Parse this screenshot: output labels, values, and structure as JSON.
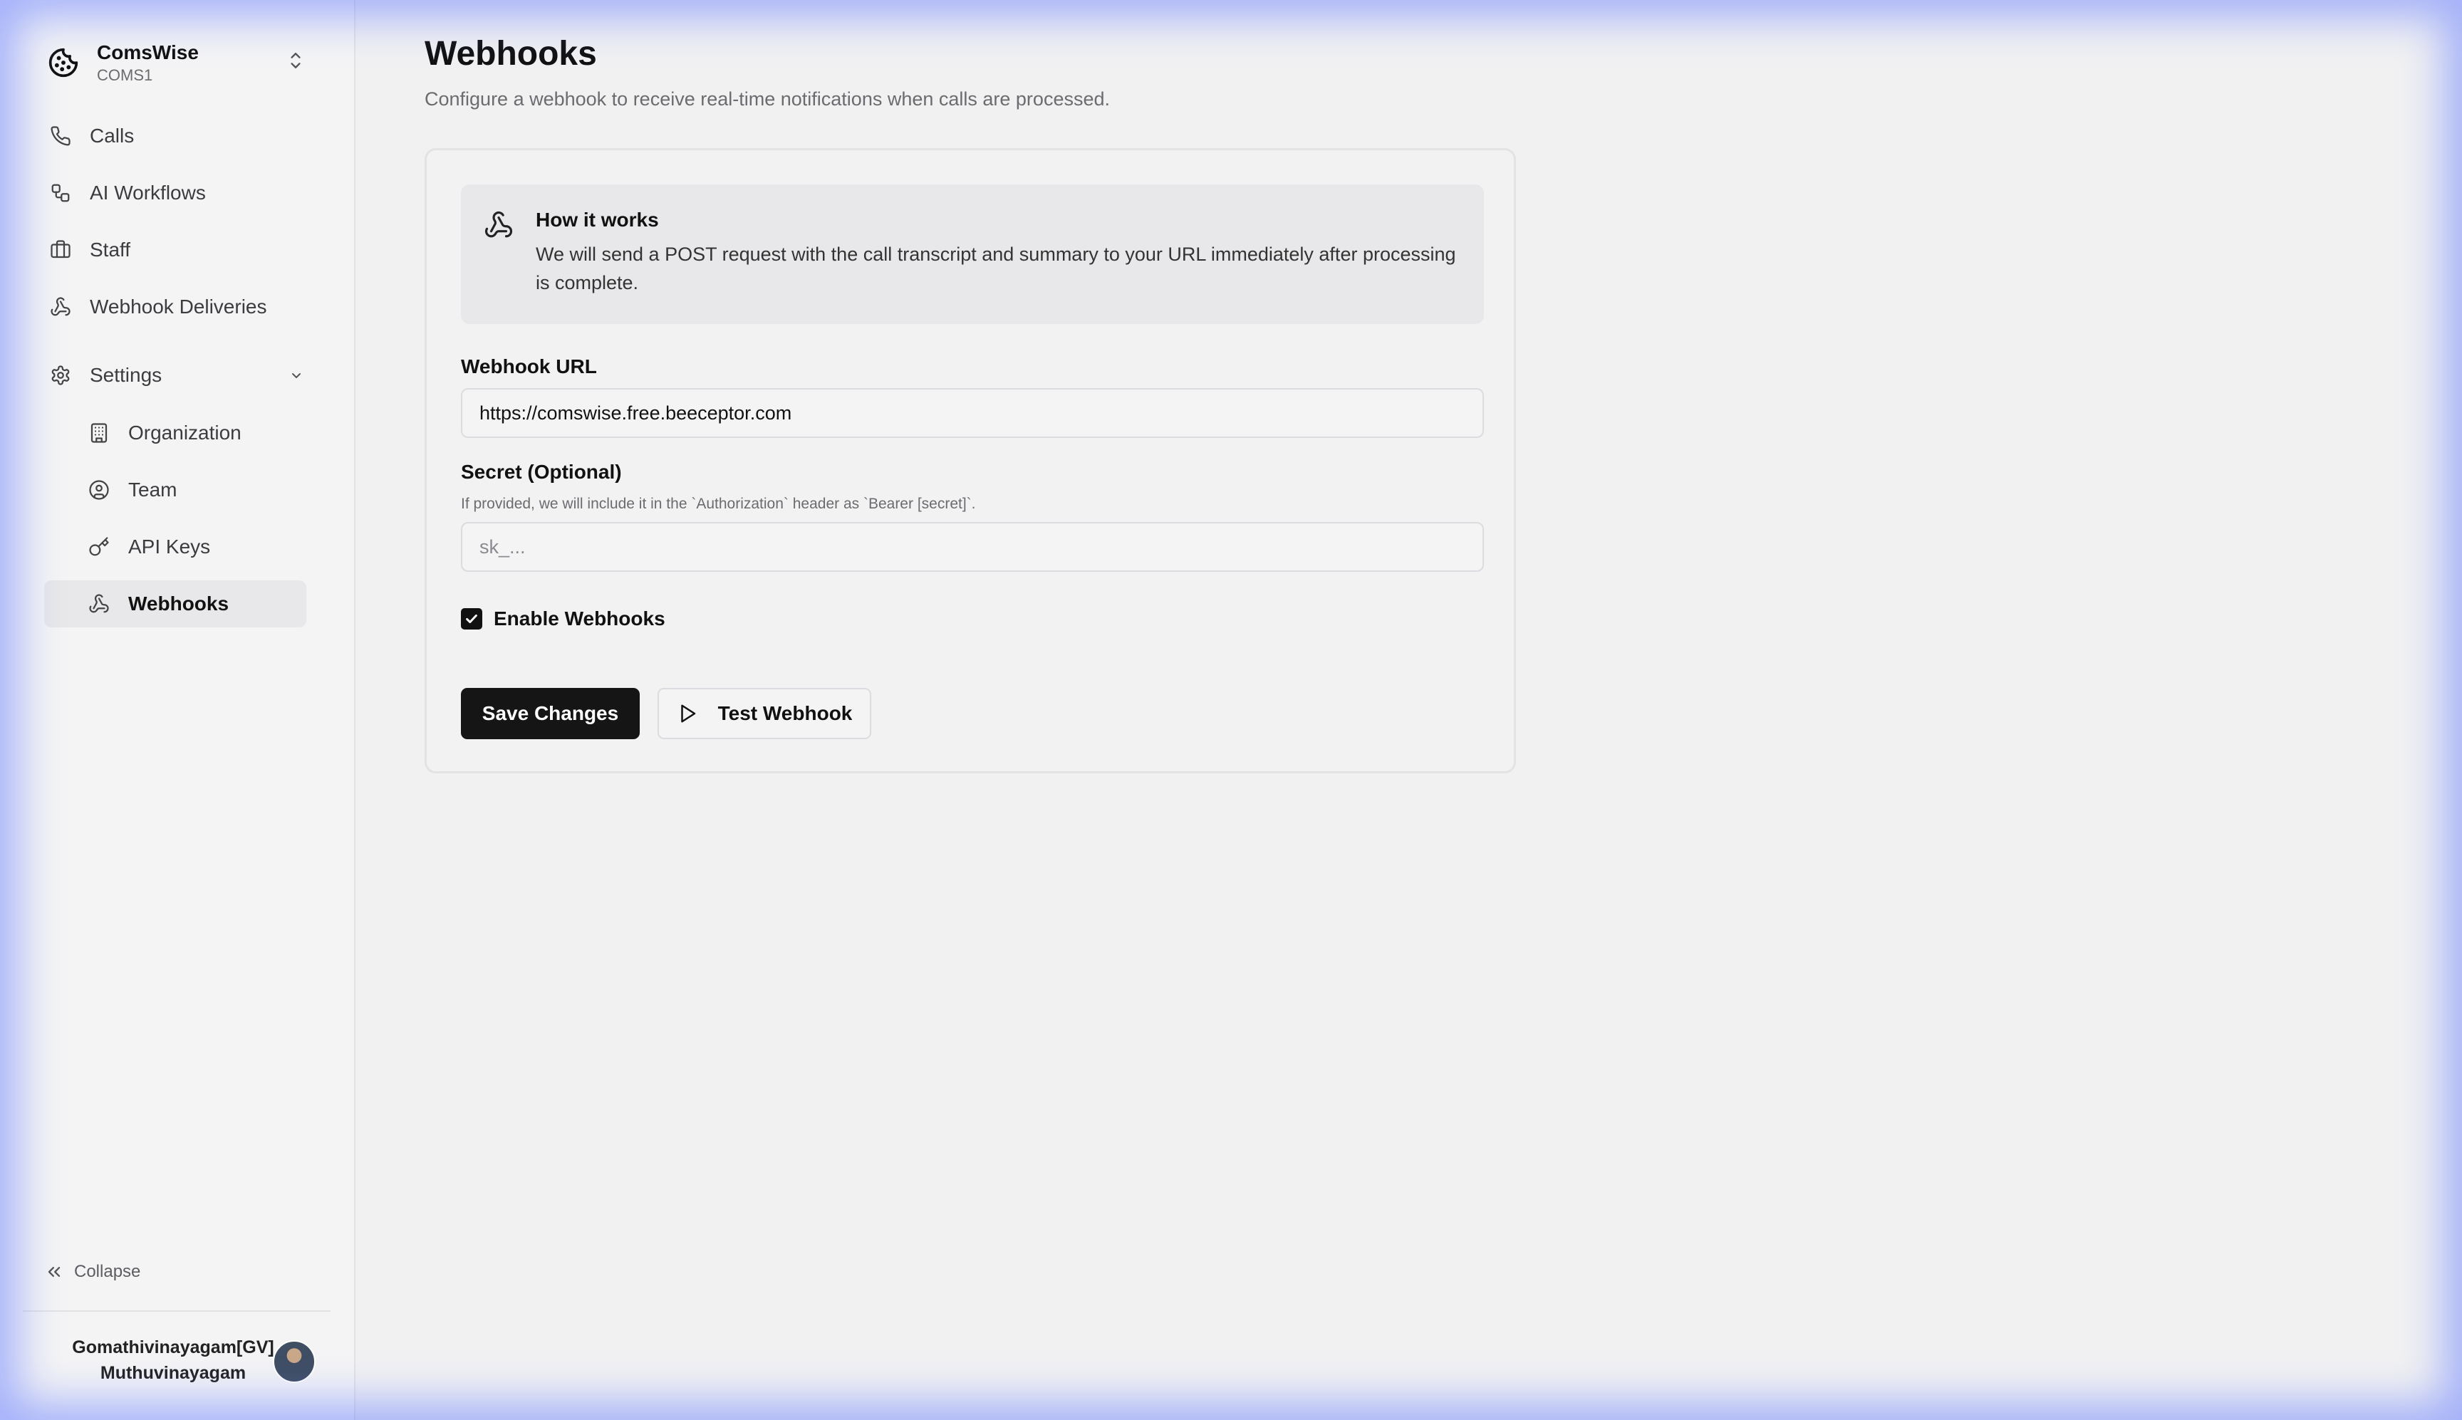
{
  "sidebar": {
    "org": {
      "name": "ComsWise",
      "code": "COMS1"
    },
    "items": [
      {
        "label": "Calls",
        "icon": "phone-icon"
      },
      {
        "label": "AI Workflows",
        "icon": "workflow-icon"
      },
      {
        "label": "Staff",
        "icon": "briefcase-icon"
      },
      {
        "label": "Webhook Deliveries",
        "icon": "webhook-icon"
      },
      {
        "label": "Settings",
        "icon": "gear-icon"
      }
    ],
    "settings_items": [
      {
        "label": "Organization",
        "icon": "building-icon"
      },
      {
        "label": "Team",
        "icon": "user-circle-icon"
      },
      {
        "label": "API Keys",
        "icon": "key-icon"
      },
      {
        "label": "Webhooks",
        "icon": "webhook-icon",
        "active": true
      }
    ],
    "collapse_label": "Collapse",
    "user": {
      "line1": "Gomathivinayagam[GV]",
      "line2": "Muthuvinayagam"
    }
  },
  "main": {
    "title": "Webhooks",
    "subtitle": "Configure a webhook to receive real-time notifications when calls are processed.",
    "info": {
      "heading": "How it works",
      "text": "We will send a POST request with the call transcript and summary to your URL immediately after processing is complete."
    },
    "url_field": {
      "label": "Webhook URL",
      "value": "https://comswise.free.beeceptor.com"
    },
    "secret_field": {
      "label": "Secret (Optional)",
      "hint": "If provided, we will include it in the `Authorization` header as `Bearer [secret]`.",
      "placeholder": "sk_..."
    },
    "enable": {
      "label": "Enable Webhooks",
      "checked": true
    },
    "buttons": {
      "save": "Save Changes",
      "test": "Test Webhook"
    }
  },
  "colors": {
    "accent_glow": "#627aff",
    "primary_button": "#151515",
    "background": "#f1f1f2"
  }
}
